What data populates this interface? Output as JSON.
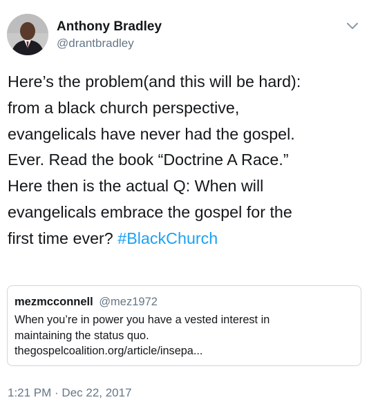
{
  "tweet": {
    "author": {
      "name": "Anthony Bradley",
      "handle": "@drantbradley",
      "avatar_icon": "profile-photo"
    },
    "menu_icon": "chevron-down-icon",
    "text": "Here’s the problem(and this will be hard):\nfrom a black church perspective,\nevangelicals have never had the gospel.\nEver. Read the book “Doctrine A Race.”\nHere then is the actual Q: When will\nevangelicals embrace the gospel for the\nfirst time ever? ",
    "hashtag": "#BlackChurch",
    "timestamp": "1:21 PM · Dec 22, 2017"
  },
  "quote": {
    "name": "mezmcconnell",
    "handle": "@mez1972",
    "lines": [
      "When you’re in power you have a vested interest in",
      "maintaining the status quo.",
      "thegospelcoalition.org/article/insepa..."
    ]
  },
  "colors": {
    "text": "#14171a",
    "secondary": "#657786",
    "link": "#1da1f2",
    "border": "#cfd6dc"
  }
}
